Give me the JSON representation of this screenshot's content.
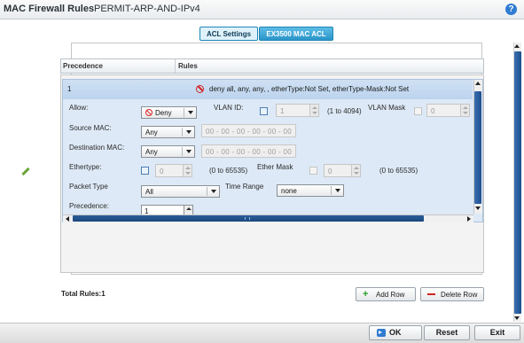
{
  "header": {
    "title": "MAC Firewall Rules",
    "subtitle": "PERMIT-ARP-AND-IPv4",
    "help_icon": "?"
  },
  "tabs": [
    {
      "label": "ACL Settings",
      "active": true
    },
    {
      "label": "EX3500 MAC ACL",
      "active": false
    }
  ],
  "table": {
    "columns": [
      "Precedence",
      "Rules"
    ],
    "rows": [
      {
        "precedence": "1",
        "rule_icon": "deny-icon",
        "rule": "deny all, any, any, , etherType:Not Set, etherType-Mask:Not Set"
      }
    ]
  },
  "editor": {
    "allow_label": "Allow:",
    "allow_value": "Deny",
    "vlan_id_label": "VLAN ID:",
    "vlan_id_value": "1",
    "vlan_id_range": "(1 to 4094)",
    "vlan_mask_label": "VLAN Mask",
    "vlan_mask_value": "0",
    "source_mac_label": "Source MAC:",
    "source_mac_value": "Any",
    "source_mac_addr": "00 - 00 - 00 - 00 - 00 - 00",
    "dest_mac_label": "Destination MAC:",
    "dest_mac_value": "Any",
    "dest_mac_addr": "00 - 00 - 00 - 00 - 00 - 00",
    "ethertype_label": "Ethertype:",
    "ethertype_value": "0",
    "ethertype_range": "(0 to 65535)",
    "ether_mask_label": "Ether Mask",
    "ether_mask_value": "0",
    "ether_mask_range": "(0 to 65535)",
    "packet_type_label": "Packet Type",
    "packet_type_value": "All",
    "time_range_label": "Time Range",
    "time_range_value": "none",
    "precedence_label": "Precedence:",
    "precedence_value": "1"
  },
  "footer": {
    "total_rules": "Total Rules:1",
    "add_row": "Add Row",
    "delete_row": "Delete Row"
  },
  "bottom_bar": {
    "ok": "OK",
    "reset": "Reset",
    "exit": "Exit"
  },
  "colors": {
    "accent": "#2b95c9",
    "row_selected": "#dde9f6",
    "deny_red": "#d42424",
    "add_green": "#2e9b2e"
  }
}
